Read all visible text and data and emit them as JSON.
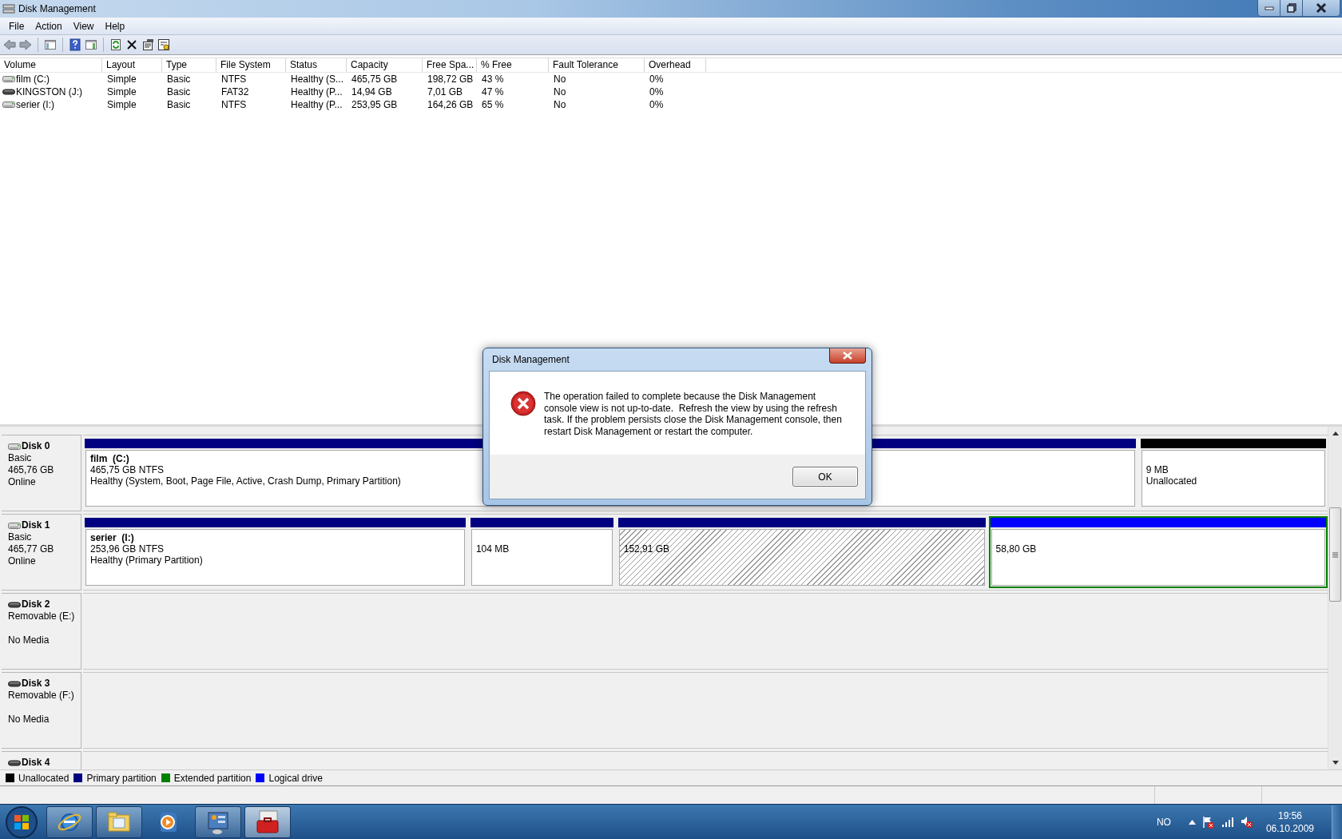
{
  "window": {
    "title": "Disk Management"
  },
  "menu": [
    "File",
    "Action",
    "View",
    "Help"
  ],
  "volume_list": {
    "columns": [
      "Volume",
      "Layout",
      "Type",
      "File System",
      "Status",
      "Capacity",
      "Free Spa...",
      "% Free",
      "Fault Tolerance",
      "Overhead"
    ],
    "rows": [
      {
        "kind": "fixed",
        "cells": [
          "film (C:)",
          "Simple",
          "Basic",
          "NTFS",
          "Healthy (S...",
          "465,75 GB",
          "198,72 GB",
          "43 %",
          "No",
          "0%"
        ]
      },
      {
        "kind": "removable",
        "cells": [
          "KINGSTON (J:)",
          "Simple",
          "Basic",
          "FAT32",
          "Healthy (P...",
          "14,94 GB",
          "7,01 GB",
          "47 %",
          "No",
          "0%"
        ]
      },
      {
        "kind": "fixed",
        "cells": [
          "serier (I:)",
          "Simple",
          "Basic",
          "NTFS",
          "Healthy (P...",
          "253,95 GB",
          "164,26 GB",
          "65 %",
          "No",
          "0%"
        ]
      }
    ]
  },
  "disks": [
    {
      "kind": "fixed",
      "name": "Disk 0",
      "type": "Basic",
      "size": "465,76 GB",
      "status": "Online",
      "partitions": [
        {
          "color": "#000080",
          "selected": false,
          "in_extended": false,
          "name": "film  (C:)",
          "size": "465,75 GB NTFS",
          "status": "Healthy (System, Boot, Page File, Active, Crash Dump, Primary Partition)"
        },
        {
          "color": "#000000",
          "selected": false,
          "in_extended": false,
          "size": "9 MB",
          "status": "Unallocated"
        }
      ]
    },
    {
      "kind": "fixed",
      "name": "Disk 1",
      "type": "Basic",
      "size": "465,77 GB",
      "status": "Online",
      "partitions": [
        {
          "color": "#000080",
          "selected": false,
          "in_extended": false,
          "name": "serier  (I:)",
          "size": "253,96 GB NTFS",
          "status": "Healthy (Primary Partition)"
        },
        {
          "color": "#000080",
          "selected": false,
          "in_extended": false,
          "size": "104 MB"
        },
        {
          "color": "#000080",
          "selected": true,
          "in_extended": false,
          "size": "152,91 GB"
        },
        {
          "color": "#0000ff",
          "selected": false,
          "in_extended": true,
          "size": "58,80 GB"
        }
      ]
    },
    {
      "kind": "removable",
      "name": "Disk 2",
      "type": "Removable (E:)",
      "status": "No Media"
    },
    {
      "kind": "removable",
      "name": "Disk 3",
      "type": "Removable (F:)",
      "status": "No Media"
    },
    {
      "kind": "removable",
      "name": "Disk 4"
    }
  ],
  "legend": [
    {
      "label": "Unallocated",
      "color": "#000000"
    },
    {
      "label": "Primary partition",
      "color": "#000080"
    },
    {
      "label": "Extended partition",
      "color": "#008000"
    },
    {
      "label": "Logical drive",
      "color": "#0000ff"
    }
  ],
  "dialog": {
    "title": "Disk Management",
    "message": "The operation failed to complete because the Disk Management console view is not up-to-date.  Refresh the view by using the refresh task. If the problem persists close the Disk Management console, then restart Disk Management or restart the computer.",
    "buttons": [
      "OK"
    ]
  },
  "taskbar": {
    "items": [
      {
        "running": true,
        "active": false
      },
      {
        "running": true,
        "active": false
      },
      {
        "running": false,
        "active": false
      },
      {
        "running": true,
        "active": false
      },
      {
        "running": true,
        "active": true
      }
    ],
    "language": "NO",
    "time": "19:56",
    "date": "06.10.2009"
  }
}
